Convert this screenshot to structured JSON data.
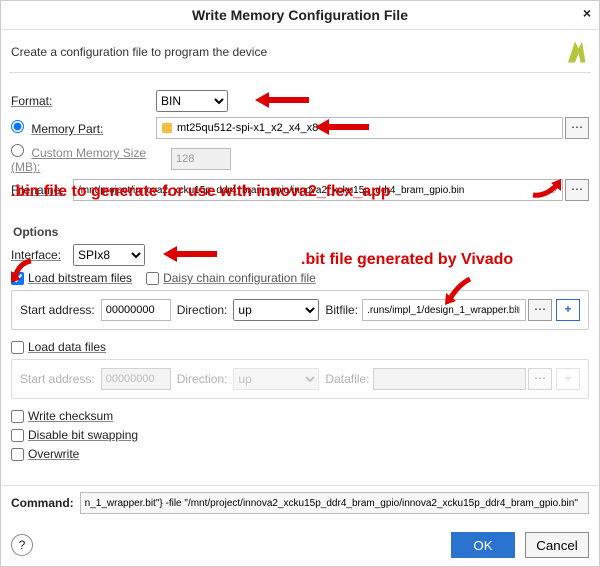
{
  "dialog": {
    "title": "Write Memory Configuration File",
    "close": "×",
    "description": "Create a configuration file to program the device"
  },
  "format": {
    "label": "Format:",
    "value": "BIN"
  },
  "memory_part": {
    "label": "Memory Part:",
    "value": "mt25qu512-spi-x1_x2_x4_x8",
    "radio_checked": true,
    "browse": "⋯"
  },
  "custom_mem": {
    "label": "Custom Memory Size (MB):",
    "value": "128",
    "radio_checked": false
  },
  "filename": {
    "label": "Filename:",
    "value": "/mnt/project/innova2_xcku15p_ddr4_bram_gpio/innova2_xcku15p_ddr4_bram_gpio.bin",
    "browse": "⋯"
  },
  "options_title": "Options",
  "interface": {
    "label": "Interface:",
    "value": "SPIx8"
  },
  "load_bitstream": {
    "label": "Load bitstream files",
    "checked": true
  },
  "daisy_chain": {
    "label": "Daisy chain configuration file",
    "checked": false
  },
  "bitstream_row": {
    "start_addr_label": "Start address:",
    "start_addr_value": "00000000",
    "direction_label": "Direction:",
    "direction_value": "up",
    "bitfile_label": "Bitfile:",
    "bitfile_value": ".runs/impl_1/design_1_wrapper.bit",
    "browse": "⋯",
    "plus": "+"
  },
  "load_data": {
    "label": "Load data files",
    "checked": false
  },
  "data_row": {
    "start_addr_label": "Start address:",
    "start_addr_value": "00000000",
    "direction_label": "Direction:",
    "direction_value": "up",
    "datafile_label": "Datafile:",
    "datafile_value": "",
    "browse": "⋯",
    "plus": "+"
  },
  "write_checksum": {
    "label": "Write checksum",
    "checked": false
  },
  "disable_bitswap": {
    "label": "Disable bit swapping",
    "checked": false
  },
  "overwrite": {
    "label": "Overwrite",
    "checked": false
  },
  "command": {
    "label": "Command:",
    "value": "n_1_wrapper.bit\"} -file \"/mnt/project/innova2_xcku15p_ddr4_bram_gpio/innova2_xcku15p_ddr4_bram_gpio.bin\""
  },
  "buttons": {
    "ok": "OK",
    "cancel": "Cancel",
    "help": "?"
  },
  "annotations": {
    "bin_note": ".bin file to generate for use with innova2_flex_app",
    "bit_note": ".bit file generated by Vivado"
  }
}
